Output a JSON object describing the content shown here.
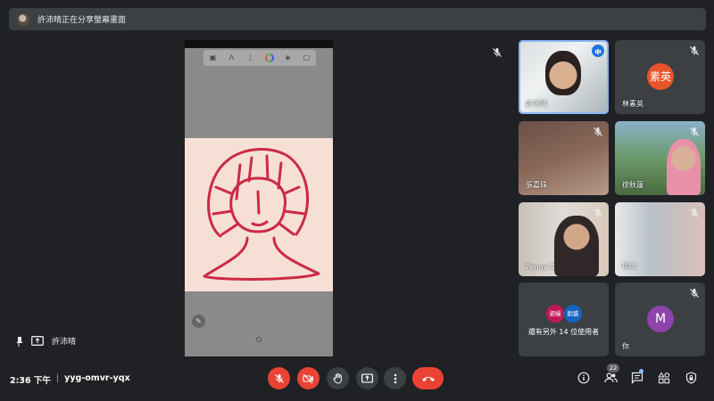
{
  "banner": {
    "text": "許沛晴正在分享螢幕畫面"
  },
  "presenter": {
    "name": "許沛晴"
  },
  "participants": [
    {
      "name": "許沛晴",
      "speaking": true
    },
    {
      "name": "林素英",
      "initials": "素英",
      "color": "#e8542a"
    },
    {
      "name": "張嘉珠"
    },
    {
      "name": "徐秋蓮"
    },
    {
      "name": "Penny C"
    },
    {
      "name": "楊山"
    }
  ],
  "others": {
    "text": "還有另外 14 位使用者",
    "avatars": [
      {
        "label": "姿嫚",
        "color": "#c2185b"
      },
      {
        "label": "創盛",
        "color": "#1565c0"
      }
    ]
  },
  "self": {
    "name": "你",
    "initial": "M",
    "color": "#8e44ad"
  },
  "meeting": {
    "time": "2:36 下午",
    "separator": "|",
    "code": "yyg-omvr-yqx"
  },
  "people_count": "22",
  "colors": {
    "end_call": "#ea4335",
    "active_border": "#8ab4f8",
    "drawing_stroke": "#cc2a44",
    "canvas_bg": "#f6e0d6"
  }
}
